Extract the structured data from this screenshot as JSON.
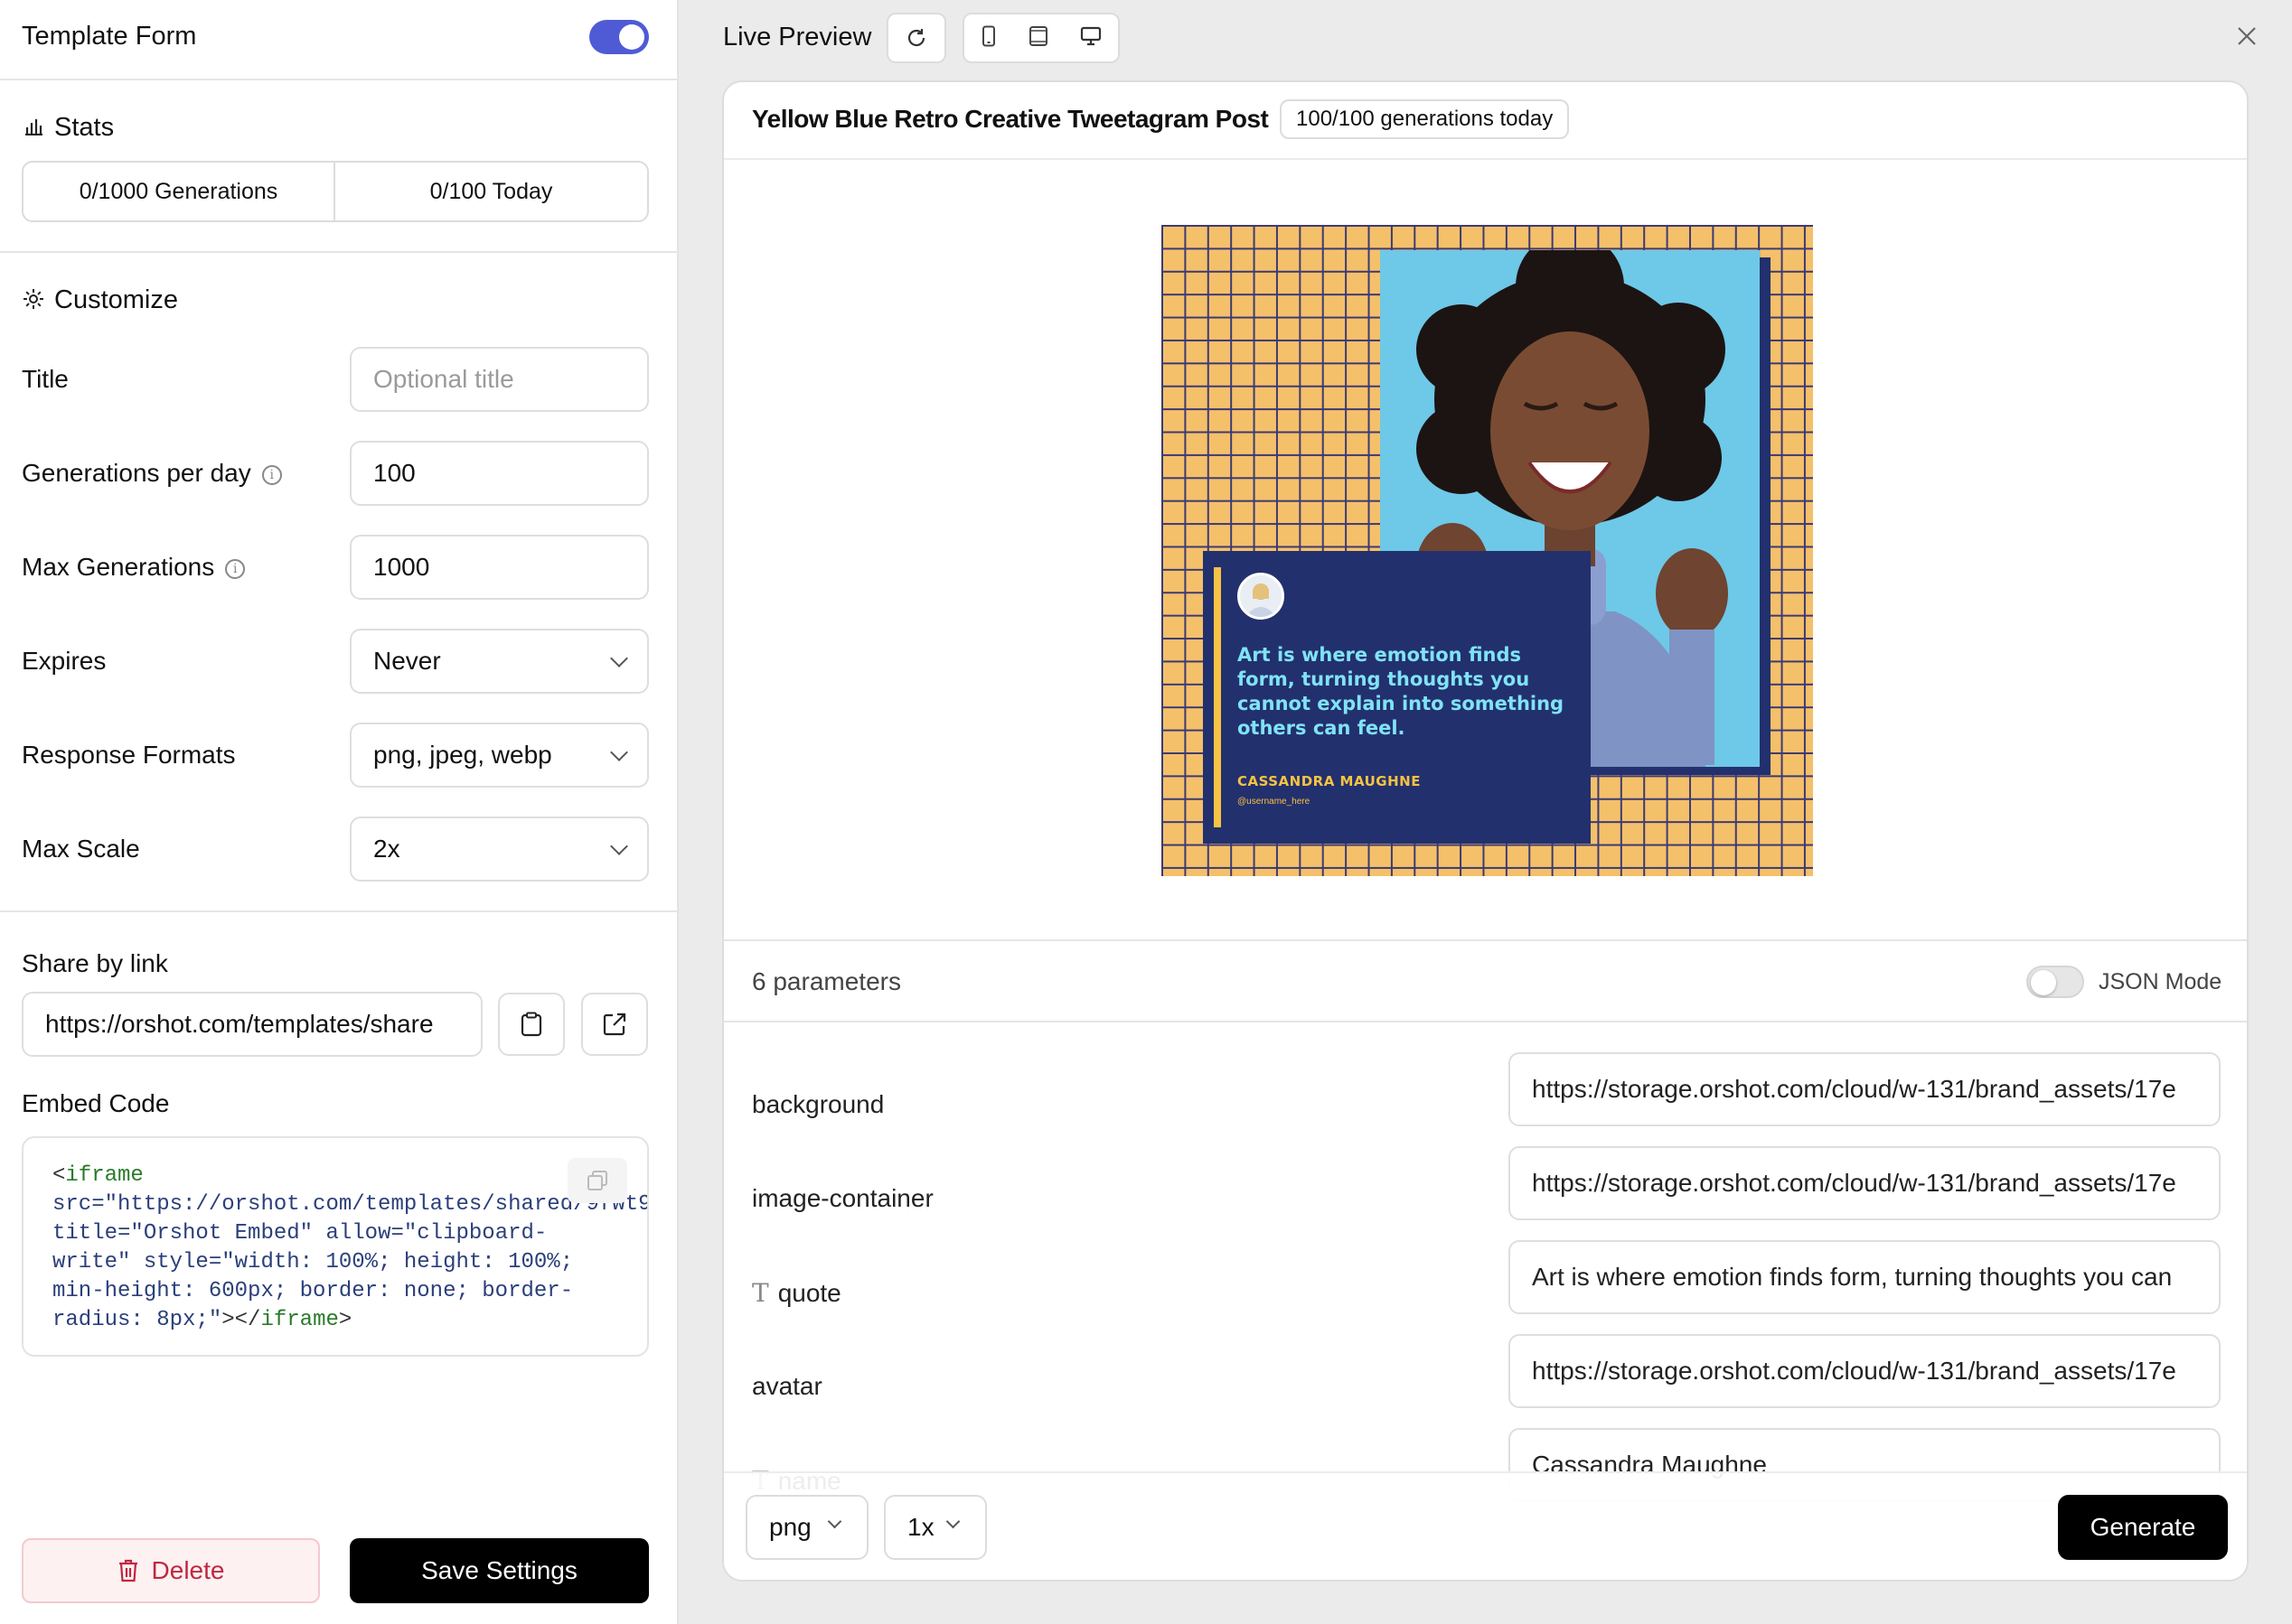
{
  "left": {
    "header_title": "Template Form",
    "stats_heading": "Stats",
    "stats_generations": "0/1000 Generations",
    "stats_today": "0/100 Today",
    "customize_heading": "Customize",
    "title_label": "Title",
    "title_placeholder": "Optional title",
    "gpd_label": "Generations per day",
    "gpd_value": "100",
    "maxgen_label": "Max Generations",
    "maxgen_value": "1000",
    "expires_label": "Expires",
    "expires_value": "Never",
    "formats_label": "Response Formats",
    "formats_value": "png, jpeg, webp",
    "scale_label": "Max Scale",
    "scale_value": "2x",
    "share_label": "Share by link",
    "share_value": "https://orshot.com/templates/share",
    "embed_label": "Embed Code",
    "embed_l1a": "<",
    "embed_l1b": "iframe",
    "embed_l2a": "src=",
    "embed_l2b": "\"https://orshot.com/templates/shared/9fwt9",
    "embed_l3a": "title=",
    "embed_l3b": "\"Orshot Embed\"",
    "embed_l3c": " allow=",
    "embed_l3d": "\"clipboard-",
    "embed_l4a": "write\"",
    "embed_l4b": " style=",
    "embed_l4c": "\"width: 100%; height: 100%;",
    "embed_l5": "min-height: 600px; border: none; border-",
    "embed_l6a": "radius: 8px;\"",
    "embed_l6b": "></",
    "embed_l6c": "iframe",
    "embed_l6d": ">",
    "delete_label": "Delete",
    "save_label": "Save Settings"
  },
  "preview": {
    "title": "Live Preview",
    "template_name": "Yellow Blue Retro Creative Tweetagram Post",
    "badge": "100/100 generations today",
    "image": {
      "quote": "Art is where emotion finds form, turning thoughts you cannot explain into something others can feel.",
      "name": "CASSANDRA MAUGHNE",
      "username": "@username_here"
    },
    "params_count": "6 parameters",
    "json_mode": "JSON Mode",
    "params": [
      {
        "name": "background",
        "value": "https://storage.orshot.com/cloud/w-131/brand_assets/17e"
      },
      {
        "name": "image-container",
        "value": "https://storage.orshot.com/cloud/w-131/brand_assets/17e"
      },
      {
        "name": "quote",
        "value": "Art is where emotion finds form, turning thoughts you can"
      },
      {
        "name": "avatar",
        "value": "https://storage.orshot.com/cloud/w-131/brand_assets/17e"
      },
      {
        "name": "name",
        "value": "Cassandra Maughne"
      }
    ],
    "format_value": "png",
    "scale_value": "1x",
    "generate_label": "Generate"
  },
  "colors": {
    "toggle_on": "#4f5bd5",
    "poster_bg": "#f4c06a",
    "poster_grid": "#3d3a72",
    "poster_navy": "#23306e",
    "poster_sky": "#6ec8e8",
    "quote_cyan": "#7fe3f5",
    "name_yellow": "#f6c344"
  }
}
